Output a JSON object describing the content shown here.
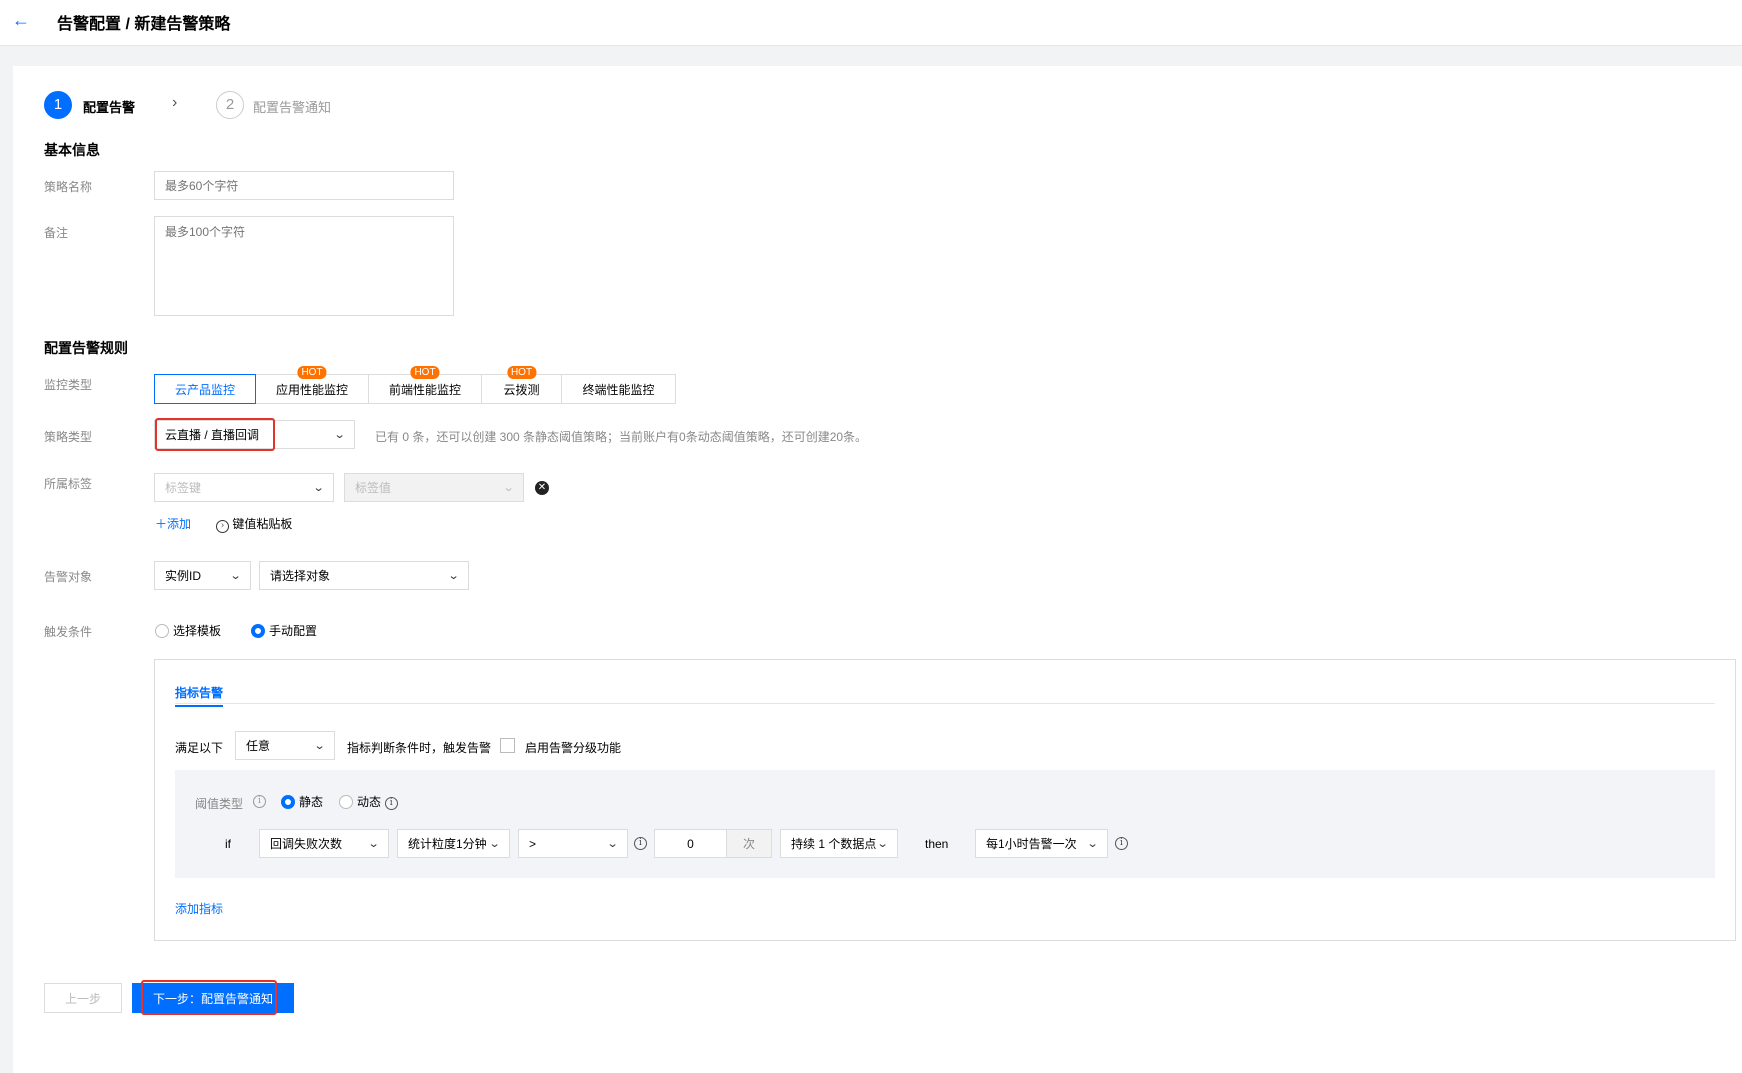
{
  "header": {
    "back_icon": "←",
    "breadcrumb": "告警配置 / 新建告警策略"
  },
  "steps": [
    {
      "num": "1",
      "label": "配置告警"
    },
    {
      "num": "2",
      "label": "配置告警通知"
    }
  ],
  "basic": {
    "title": "基本信息",
    "name_label": "策略名称",
    "name_placeholder": "最多60个字符",
    "remark_label": "备注",
    "remark_placeholder": "最多100个字符"
  },
  "rules": {
    "title": "配置告警规则",
    "monitor_label": "监控类型",
    "monitor_tabs": [
      "云产品监控",
      "应用性能监控",
      "前端性能监控",
      "云拨测",
      "终端性能监控"
    ],
    "hot_badge": "HOT",
    "policy_label": "策略类型",
    "policy_value": "云直播 / 直播回调",
    "policy_hint": "已有 0 条，还可以创建 300 条静态阈值策略；当前账户有0条动态阈值策略，还可创建20条。",
    "tag_label": "所属标签",
    "tag_key_placeholder": "标签键",
    "tag_value_placeholder": "标签值",
    "add_link": "添加",
    "paste_link": "键值粘贴板",
    "target_label": "告警对象",
    "target_type": "实例ID",
    "target_placeholder": "请选择对象",
    "trigger_label": "触发条件",
    "trigger_options": [
      "选择模板",
      "手动配置"
    ]
  },
  "condition": {
    "tab": "指标告警",
    "meet_prefix": "满足以下",
    "meet_value": "任意",
    "meet_suffix": "指标判断条件时，触发告警",
    "level_checkbox": "启用告警分级功能",
    "threshold_label": "阈值类型",
    "threshold_options": [
      "静态",
      "动态"
    ],
    "if_text": "if",
    "metric": "回调失败次数",
    "granularity": "统计粒度1分钟",
    "operator": ">",
    "value": "0",
    "unit": "次",
    "duration": "持续 1 个数据点",
    "then_text": "then",
    "frequency": "每1小时告警一次",
    "add_metric": "添加指标"
  },
  "footer": {
    "prev": "上一步",
    "next": "下一步：配置告警通知"
  },
  "colors": {
    "primary": "#006eff",
    "hot": "#ff7200",
    "highlight": "#e5332b"
  }
}
